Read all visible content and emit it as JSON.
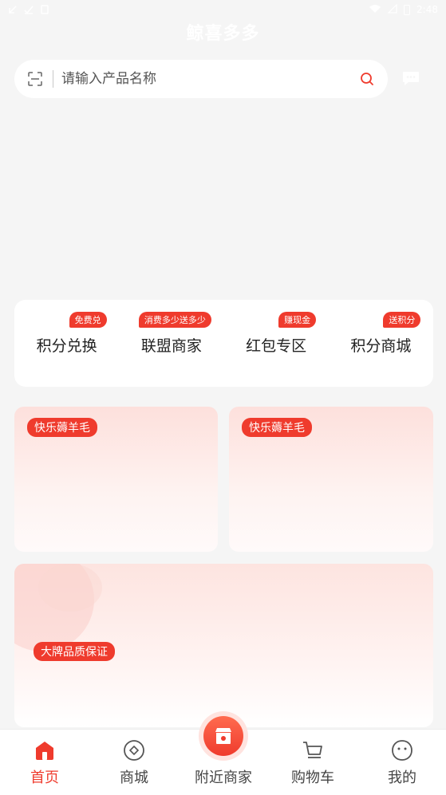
{
  "status_bar": {
    "time": "2:48",
    "icons": [
      "download-icon",
      "check-icon",
      "sim-icon",
      "wifi-icon",
      "signal-icon",
      "battery-icon"
    ]
  },
  "app": {
    "title": "鲸喜多多"
  },
  "search": {
    "placeholder": "请输入产品名称",
    "value": ""
  },
  "categories": [
    {
      "label": "积分兑换",
      "badge": "免费兑"
    },
    {
      "label": "联盟商家",
      "badge": "消费多少送多少"
    },
    {
      "label": "红包专区",
      "badge": "赚现金"
    },
    {
      "label": "积分商城",
      "badge": "送积分"
    }
  ],
  "promos": [
    {
      "tag": "快乐薅羊毛"
    },
    {
      "tag": "快乐薅羊毛"
    },
    {
      "tag": "大牌品质保证"
    }
  ],
  "tabbar": {
    "home": "首页",
    "mall": "商城",
    "nearby": "附近商家",
    "cart": "购物车",
    "mine": "我的"
  },
  "colors": {
    "accent": "#ef3b2d",
    "background": "#f5f5f5",
    "card": "#ffffff"
  }
}
